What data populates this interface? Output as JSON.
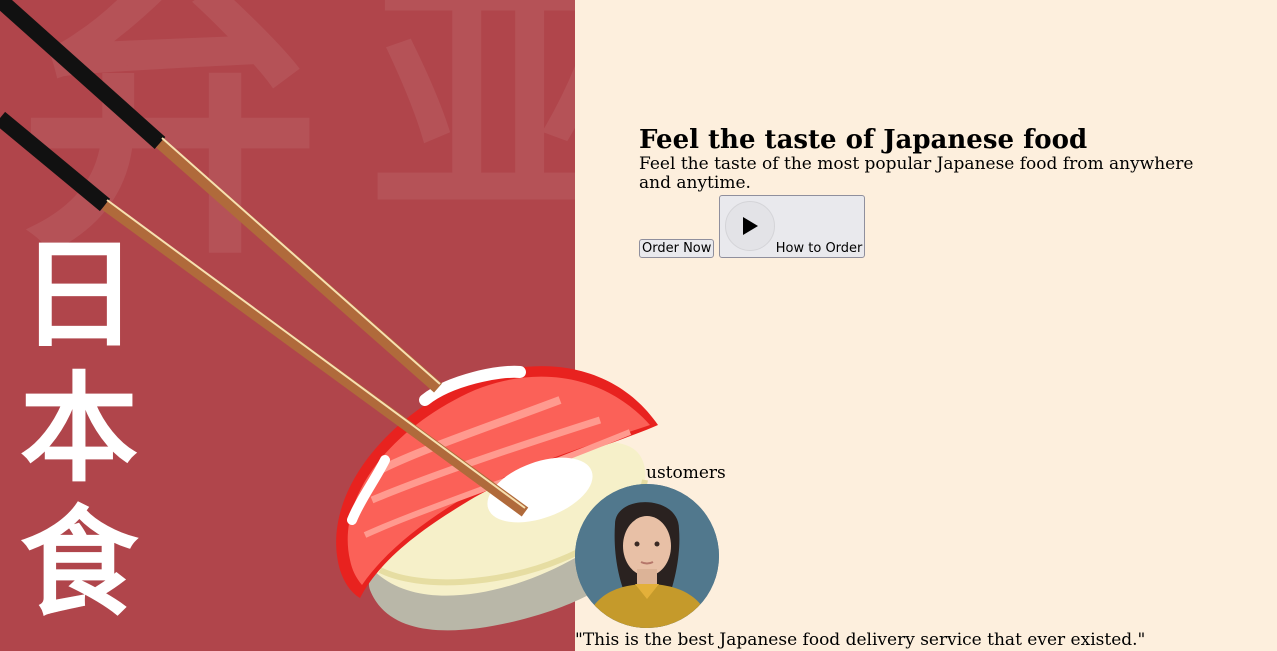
{
  "background": {
    "left_color": "#b0454b",
    "right_color": "#fdefdd",
    "watermark_kanji": [
      "弁",
      "亚"
    ]
  },
  "vertical_title": [
    "日",
    "本",
    "食"
  ],
  "hero": {
    "title": "Feel the taste of Japanese food",
    "subtitle": "Feel the taste of the most popular Japanese food from anywhere and anytime.",
    "order_button": "Order Now",
    "how_button": "How to Order",
    "play_icon": "play-icon"
  },
  "testimonial": {
    "heading_visible": "ustomers",
    "quote": "\"This is the best Japanese food delivery service that ever existed.\""
  }
}
